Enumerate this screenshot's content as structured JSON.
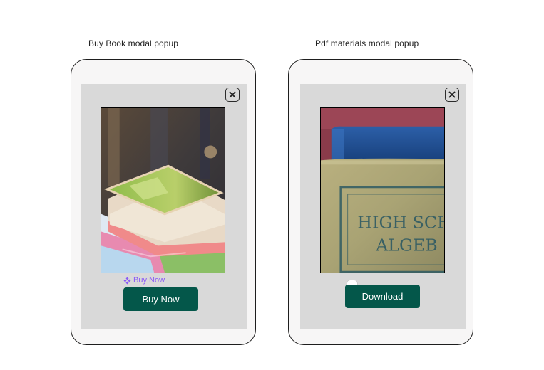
{
  "frames": [
    {
      "caption": "Buy Book modal popup",
      "close_icon": "close-icon",
      "image": "stack-of-books-photo",
      "component_tag": "Buy Now",
      "button_label": "Buy Now"
    },
    {
      "caption": "Pdf materials modal popup",
      "close_icon": "close-icon",
      "image": "algebra-book-photo",
      "cover_text_line1": "HIGH SCH",
      "cover_text_line2": "ALGEB",
      "button_label": "Download"
    }
  ],
  "colors": {
    "button_bg": "#04574a",
    "modal_bg": "#d9d9d9",
    "device_bg": "#f7f6f6",
    "component_tag": "#8b5cf6"
  }
}
